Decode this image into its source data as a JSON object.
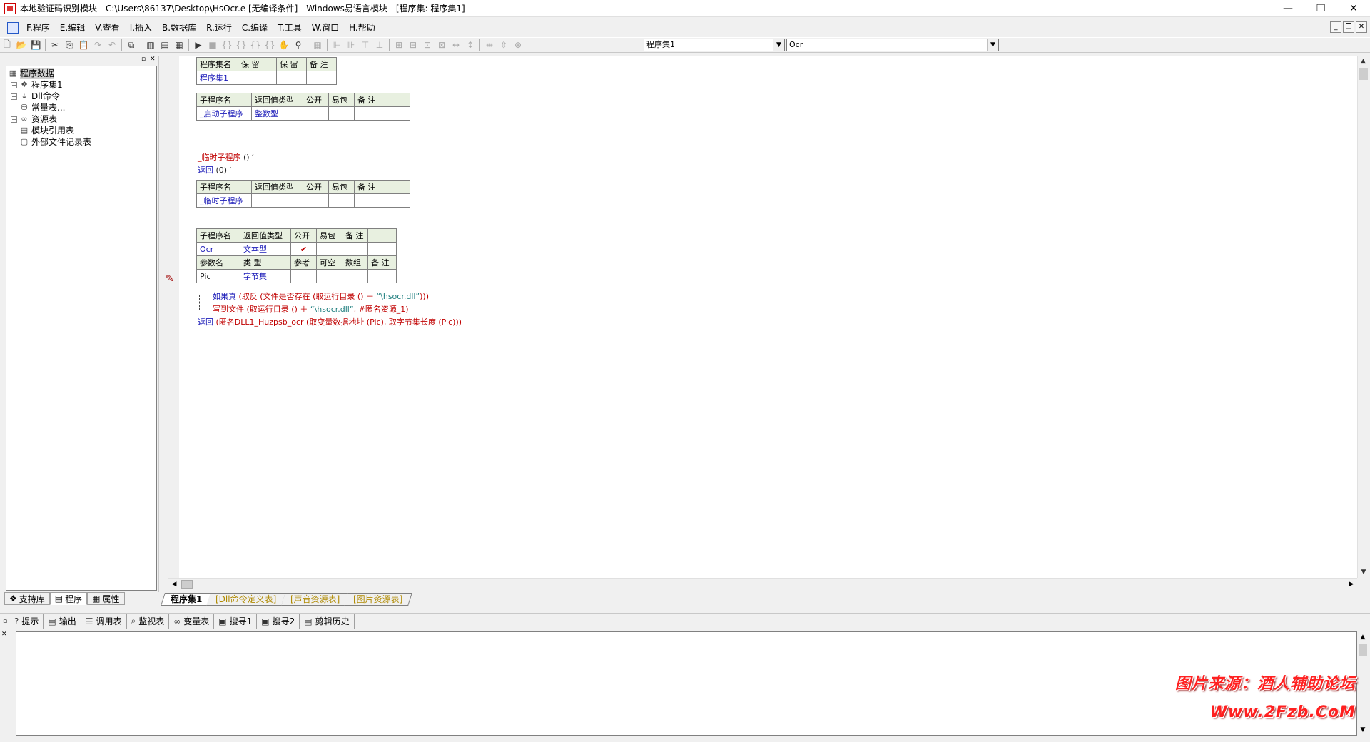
{
  "window": {
    "title": "本地验证码识别模块 - C:\\Users\\86137\\Desktop\\HsOcr.e [无编译条件] - Windows易语言模块 - [程序集: 程序集1]",
    "minimize": "—",
    "restore": "❐",
    "close": "✕"
  },
  "menu": [
    {
      "label": "F.程序"
    },
    {
      "label": "E.编辑"
    },
    {
      "label": "V.查看"
    },
    {
      "label": "I.插入"
    },
    {
      "label": "B.数据库"
    },
    {
      "label": "R.运行"
    },
    {
      "label": "C.编译"
    },
    {
      "label": "T.工具"
    },
    {
      "label": "W.窗口"
    },
    {
      "label": "H.帮助"
    }
  ],
  "combos": {
    "assembly": "程序集1",
    "subroutine": "Ocr"
  },
  "tree": {
    "root": "程序数据",
    "items": [
      {
        "label": "程序集1",
        "expand": "+",
        "icon": "❖"
      },
      {
        "label": "Dll命令",
        "expand": "+",
        "icon": "⇣"
      },
      {
        "label": "常量表...",
        "expand": "",
        "icon": "⛁"
      },
      {
        "label": "资源表",
        "expand": "+",
        "icon": "∞"
      },
      {
        "label": "模块引用表",
        "expand": "",
        "icon": "▤"
      },
      {
        "label": "外部文件记录表",
        "expand": "",
        "icon": "▢"
      }
    ]
  },
  "left_tabs": [
    {
      "label": "支持库"
    },
    {
      "label": "程序"
    },
    {
      "label": "属性"
    }
  ],
  "assembly_table": {
    "headers": [
      "程序集名",
      "保 留",
      "保 留",
      "备 注"
    ],
    "row": [
      "程序集1",
      "",
      "",
      ""
    ]
  },
  "sub_start": {
    "headers": [
      "子程序名",
      "返回值类型",
      "公开",
      "易包",
      "备 注"
    ],
    "row": [
      "_启动子程序",
      "整数型",
      "",
      "",
      ""
    ]
  },
  "temp_code": {
    "line1_name": "_临时子程序",
    "line1_rest": " () ′",
    "line2_kw": "返回",
    "line2_rest": " (0)  ′"
  },
  "sub_temp": {
    "headers": [
      "子程序名",
      "返回值类型",
      "公开",
      "易包",
      "备 注"
    ],
    "row": [
      "_临时子程序",
      "",
      "",
      "",
      ""
    ]
  },
  "sub_ocr": {
    "headers": [
      "子程序名",
      "返回值类型",
      "公开",
      "易包",
      "备 注"
    ],
    "row": [
      "Ocr",
      "文本型",
      "✔",
      "",
      ""
    ],
    "param_headers": [
      "参数名",
      "类 型",
      "参考",
      "可空",
      "数组",
      "备 注"
    ],
    "param_row": [
      "Pic",
      "字节集",
      "",
      "",
      "",
      ""
    ]
  },
  "code_lines": {
    "l1_kw": "如果真",
    "l1_a": " (取反 (文件是否存在 (取运行目录 () ＋ ",
    "l1_str": "“\\hsocr.dll”",
    "l1_b": ")))",
    "l2_kw": "写到文件",
    "l2_a": " (取运行目录 () ＋ ",
    "l2_str": "“\\hsocr.dll”",
    "l2_b": ", #匿名资源_1)",
    "l3_kw": "返回",
    "l3_a": " (匿名DLL1_Huzpsb_ocr (取变量数据地址 (Pic), 取字节集长度 (Pic)))"
  },
  "doc_tabs": [
    {
      "label": "程序集1"
    },
    {
      "label": "[Dll命令定义表]"
    },
    {
      "label": "[声音资源表]"
    },
    {
      "label": "[图片资源表]"
    }
  ],
  "bottom_tabs": [
    {
      "label": "提示",
      "icon": "?"
    },
    {
      "label": "输出",
      "icon": "▤"
    },
    {
      "label": "调用表",
      "icon": "☰"
    },
    {
      "label": "监视表",
      "icon": "⌕"
    },
    {
      "label": "变量表",
      "icon": "∞"
    },
    {
      "label": "搜寻1",
      "icon": "▣"
    },
    {
      "label": "搜寻2",
      "icon": "▣"
    },
    {
      "label": "剪辑历史",
      "icon": "▤"
    }
  ],
  "watermark": {
    "line1": "图片来源：酒人辅助论坛",
    "line2": "Www.2Fzb.CoM"
  },
  "colors": {
    "keyword": "#1a1ab8",
    "call": "#c00000",
    "string": "#1e7e7e"
  }
}
